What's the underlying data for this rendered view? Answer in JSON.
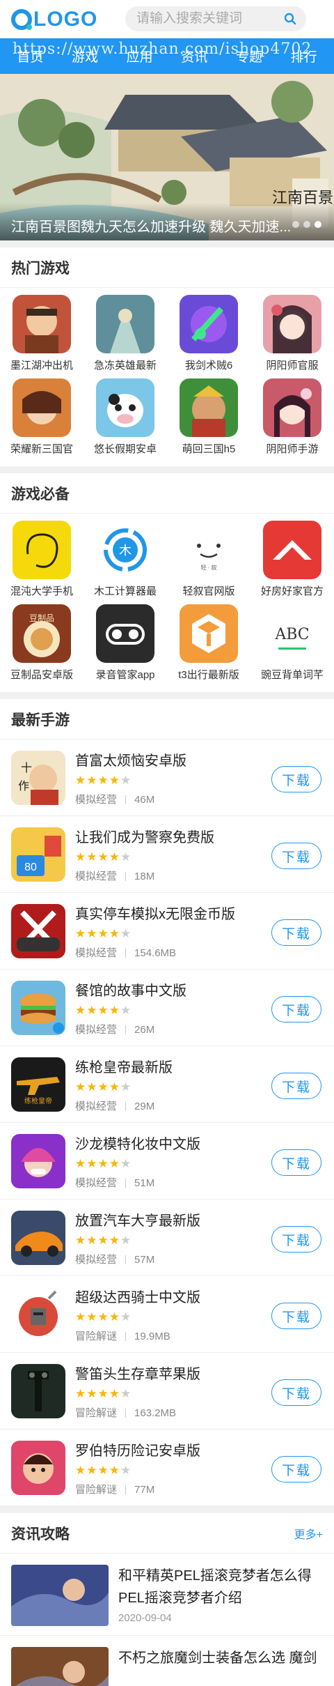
{
  "header": {
    "logo_text": "LOGO",
    "search_placeholder": "请输入搜索关键词"
  },
  "nav": {
    "items": [
      "首页",
      "游戏",
      "应用",
      "资讯",
      "专题",
      "排行"
    ],
    "watermark": "https://www.huzhan.com/ishop4702"
  },
  "banner": {
    "caption": "江南百景图魏九天怎么加速升级 魏久天加速...",
    "logo_text": "江南百景图",
    "dots": 3,
    "active_dot": 2
  },
  "hot_games": {
    "title": "热门游戏",
    "items": [
      {
        "label": "墨江湖冲出机",
        "icon": "warrior-icon",
        "color": "#c0533a"
      },
      {
        "label": "急冻英雄最新",
        "icon": "hero-icon",
        "color": "#5f8f9a"
      },
      {
        "label": "我剑术贼6",
        "icon": "sword-icon",
        "color": "#6a4bd8"
      },
      {
        "label": "阴阳师官服",
        "icon": "onmyoji-icon",
        "color": "#e8a0a8"
      },
      {
        "label": "荣耀新三国官",
        "icon": "three-kingdoms-icon",
        "color": "#d9803a"
      },
      {
        "label": "悠长假期安卓",
        "icon": "cow-icon",
        "color": "#7cc6e8"
      },
      {
        "label": "萌回三国h5",
        "icon": "general-icon",
        "color": "#3f8f3a"
      },
      {
        "label": "阴阳师手游",
        "icon": "onmyoji-girl-icon",
        "color": "#c85a6a"
      }
    ]
  },
  "essential_games": {
    "title": "游戏必备",
    "items": [
      {
        "label": "混沌大学手机",
        "icon": "chaos-icon",
        "color": "#f5d90a"
      },
      {
        "label": "木工计算器最",
        "icon": "wood-icon",
        "color": "#ffffff"
      },
      {
        "label": "轻叙官网版",
        "icon": "qingxu-icon",
        "color": "#ffffff"
      },
      {
        "label": "好房好家官方",
        "icon": "house-icon",
        "color": "#e53935"
      },
      {
        "label": "豆制品安卓版",
        "icon": "tofu-icon",
        "color": "#8a3a1e"
      },
      {
        "label": "录音管家app",
        "icon": "recorder-icon",
        "color": "#2b2b2b"
      },
      {
        "label": "t3出行最新版",
        "icon": "t3-icon",
        "color": "#f39c3c"
      },
      {
        "label": "豌豆背单词芊",
        "icon": "abc-icon",
        "color": "#ffffff"
      }
    ],
    "abc_text": "ABC"
  },
  "latest_games": {
    "title": "最新手游",
    "download_label": "下载",
    "items": [
      {
        "title": "首富太烦恼安卓版",
        "category": "模拟经营",
        "size": "46M",
        "rating": 4,
        "icon": "rich-man-icon",
        "color": "#f3e6c8"
      },
      {
        "title": "让我们成为警察免费版",
        "category": "模拟经营",
        "size": "18M",
        "rating": 4,
        "icon": "police-icon",
        "color": "#f6c84a"
      },
      {
        "title": "真实停车模拟x无限金币版",
        "category": "模拟经营",
        "size": "154.6MB",
        "rating": 4,
        "icon": "parking-icon",
        "color": "#b01c1c"
      },
      {
        "title": "餐馆的故事中文版",
        "category": "模拟经营",
        "size": "26M",
        "rating": 4,
        "icon": "burger-icon",
        "color": "#6fb8e0"
      },
      {
        "title": "练枪皇帝最新版",
        "category": "模拟经营",
        "size": "29M",
        "rating": 4,
        "icon": "gun-icon",
        "color": "#1a1a1a"
      },
      {
        "title": "沙龙模特化妆中文版",
        "category": "模拟经营",
        "size": "51M",
        "rating": 4,
        "icon": "makeup-icon",
        "color": "#8a2fc9"
      },
      {
        "title": "放置汽车大亨最新版",
        "category": "模拟经营",
        "size": "57M",
        "rating": 4,
        "icon": "car-icon",
        "color": "#f08a1a"
      },
      {
        "title": "超级达西骑士中文版",
        "category": "冒险解谜",
        "size": "19.9MB",
        "rating": 4,
        "icon": "knight-icon",
        "color": "#d94a3a"
      },
      {
        "title": "警笛头生存章苹果版",
        "category": "冒险解谜",
        "size": "163.2MB",
        "rating": 4,
        "icon": "siren-head-icon",
        "color": "#1f2a24"
      },
      {
        "title": "罗伯特历险记安卓版",
        "category": "冒险解谜",
        "size": "77M",
        "rating": 4,
        "icon": "robert-icon",
        "color": "#e0456a"
      }
    ]
  },
  "news": {
    "title": "资讯攻略",
    "more_label": "更多+",
    "items": [
      {
        "title": "和平精英PEL摇滚竞梦者怎么得 PEL摇滚竞梦者介绍",
        "date": "2020-09-04",
        "color": "#3a4a8a"
      },
      {
        "title": "不朽之旅魔剑士装备怎么选 魔剑",
        "date": "",
        "color": "#7a4a2a"
      }
    ]
  }
}
